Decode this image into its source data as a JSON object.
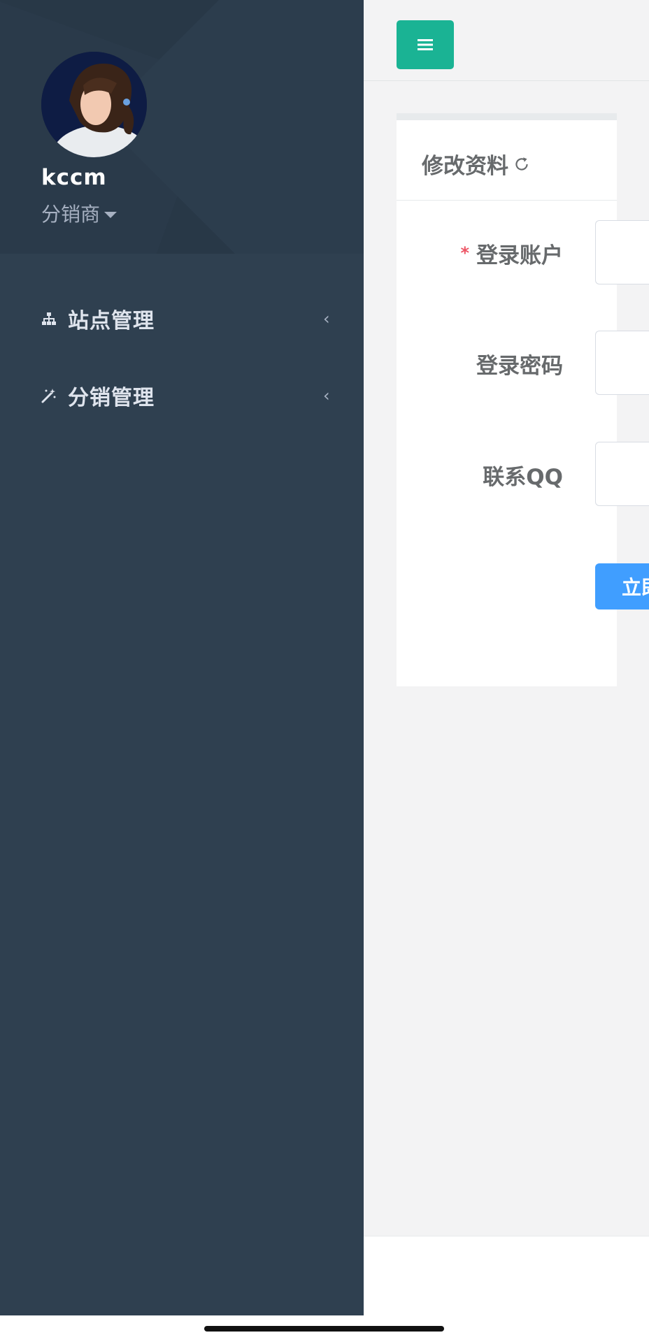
{
  "profile": {
    "username": "kccm",
    "role": "分销商"
  },
  "sidebar": {
    "items": [
      {
        "label": "站点管理",
        "icon": "sitemap-icon"
      },
      {
        "label": "分销管理",
        "icon": "magic-wand-icon"
      }
    ]
  },
  "topbar": {
    "menu_icon": "hamburger-icon"
  },
  "panel": {
    "title": "修改资料",
    "refresh_icon": "refresh-icon",
    "fields": [
      {
        "label": "登录账户",
        "required": true,
        "value": ""
      },
      {
        "label": "登录密码",
        "required": false,
        "value": ""
      },
      {
        "label": "联系QQ",
        "required": false,
        "value": ""
      }
    ],
    "required_mark": "*",
    "submit_label": "立即"
  },
  "colors": {
    "sidebar_bg": "#2f4050",
    "accent": "#1ab394",
    "primary_button": "#409eff",
    "required": "#ed5565"
  }
}
